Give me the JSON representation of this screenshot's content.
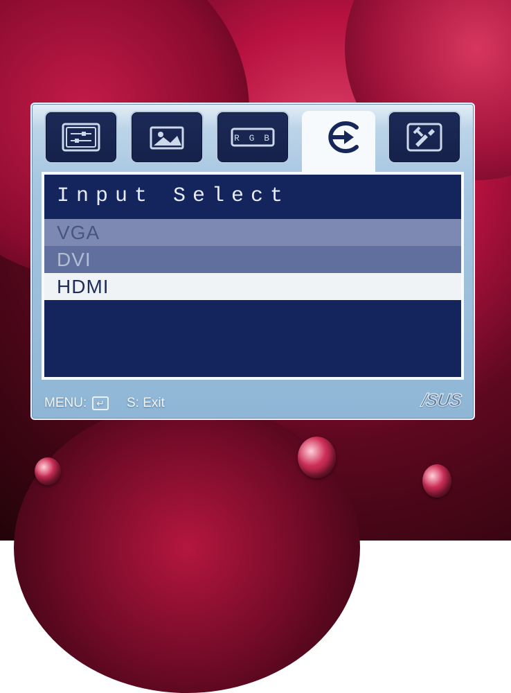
{
  "osd": {
    "tabs": [
      {
        "id": "splendor",
        "icon": "sliders-icon"
      },
      {
        "id": "image",
        "icon": "picture-icon"
      },
      {
        "id": "color",
        "icon": "rgb-icon",
        "rgb_label": "R G B"
      },
      {
        "id": "input",
        "icon": "input-arrow-icon",
        "active": true
      },
      {
        "id": "system",
        "icon": "tools-icon"
      }
    ],
    "title": "Input Select",
    "items": [
      {
        "label": "VGA",
        "state": "unavailable"
      },
      {
        "label": "DVI",
        "state": "available"
      },
      {
        "label": "HDMI",
        "state": "selected"
      }
    ],
    "footer": {
      "menu_label": "MENU:",
      "enter_glyph": "↵",
      "exit_label": "S: Exit",
      "brand": "/SUS"
    }
  }
}
